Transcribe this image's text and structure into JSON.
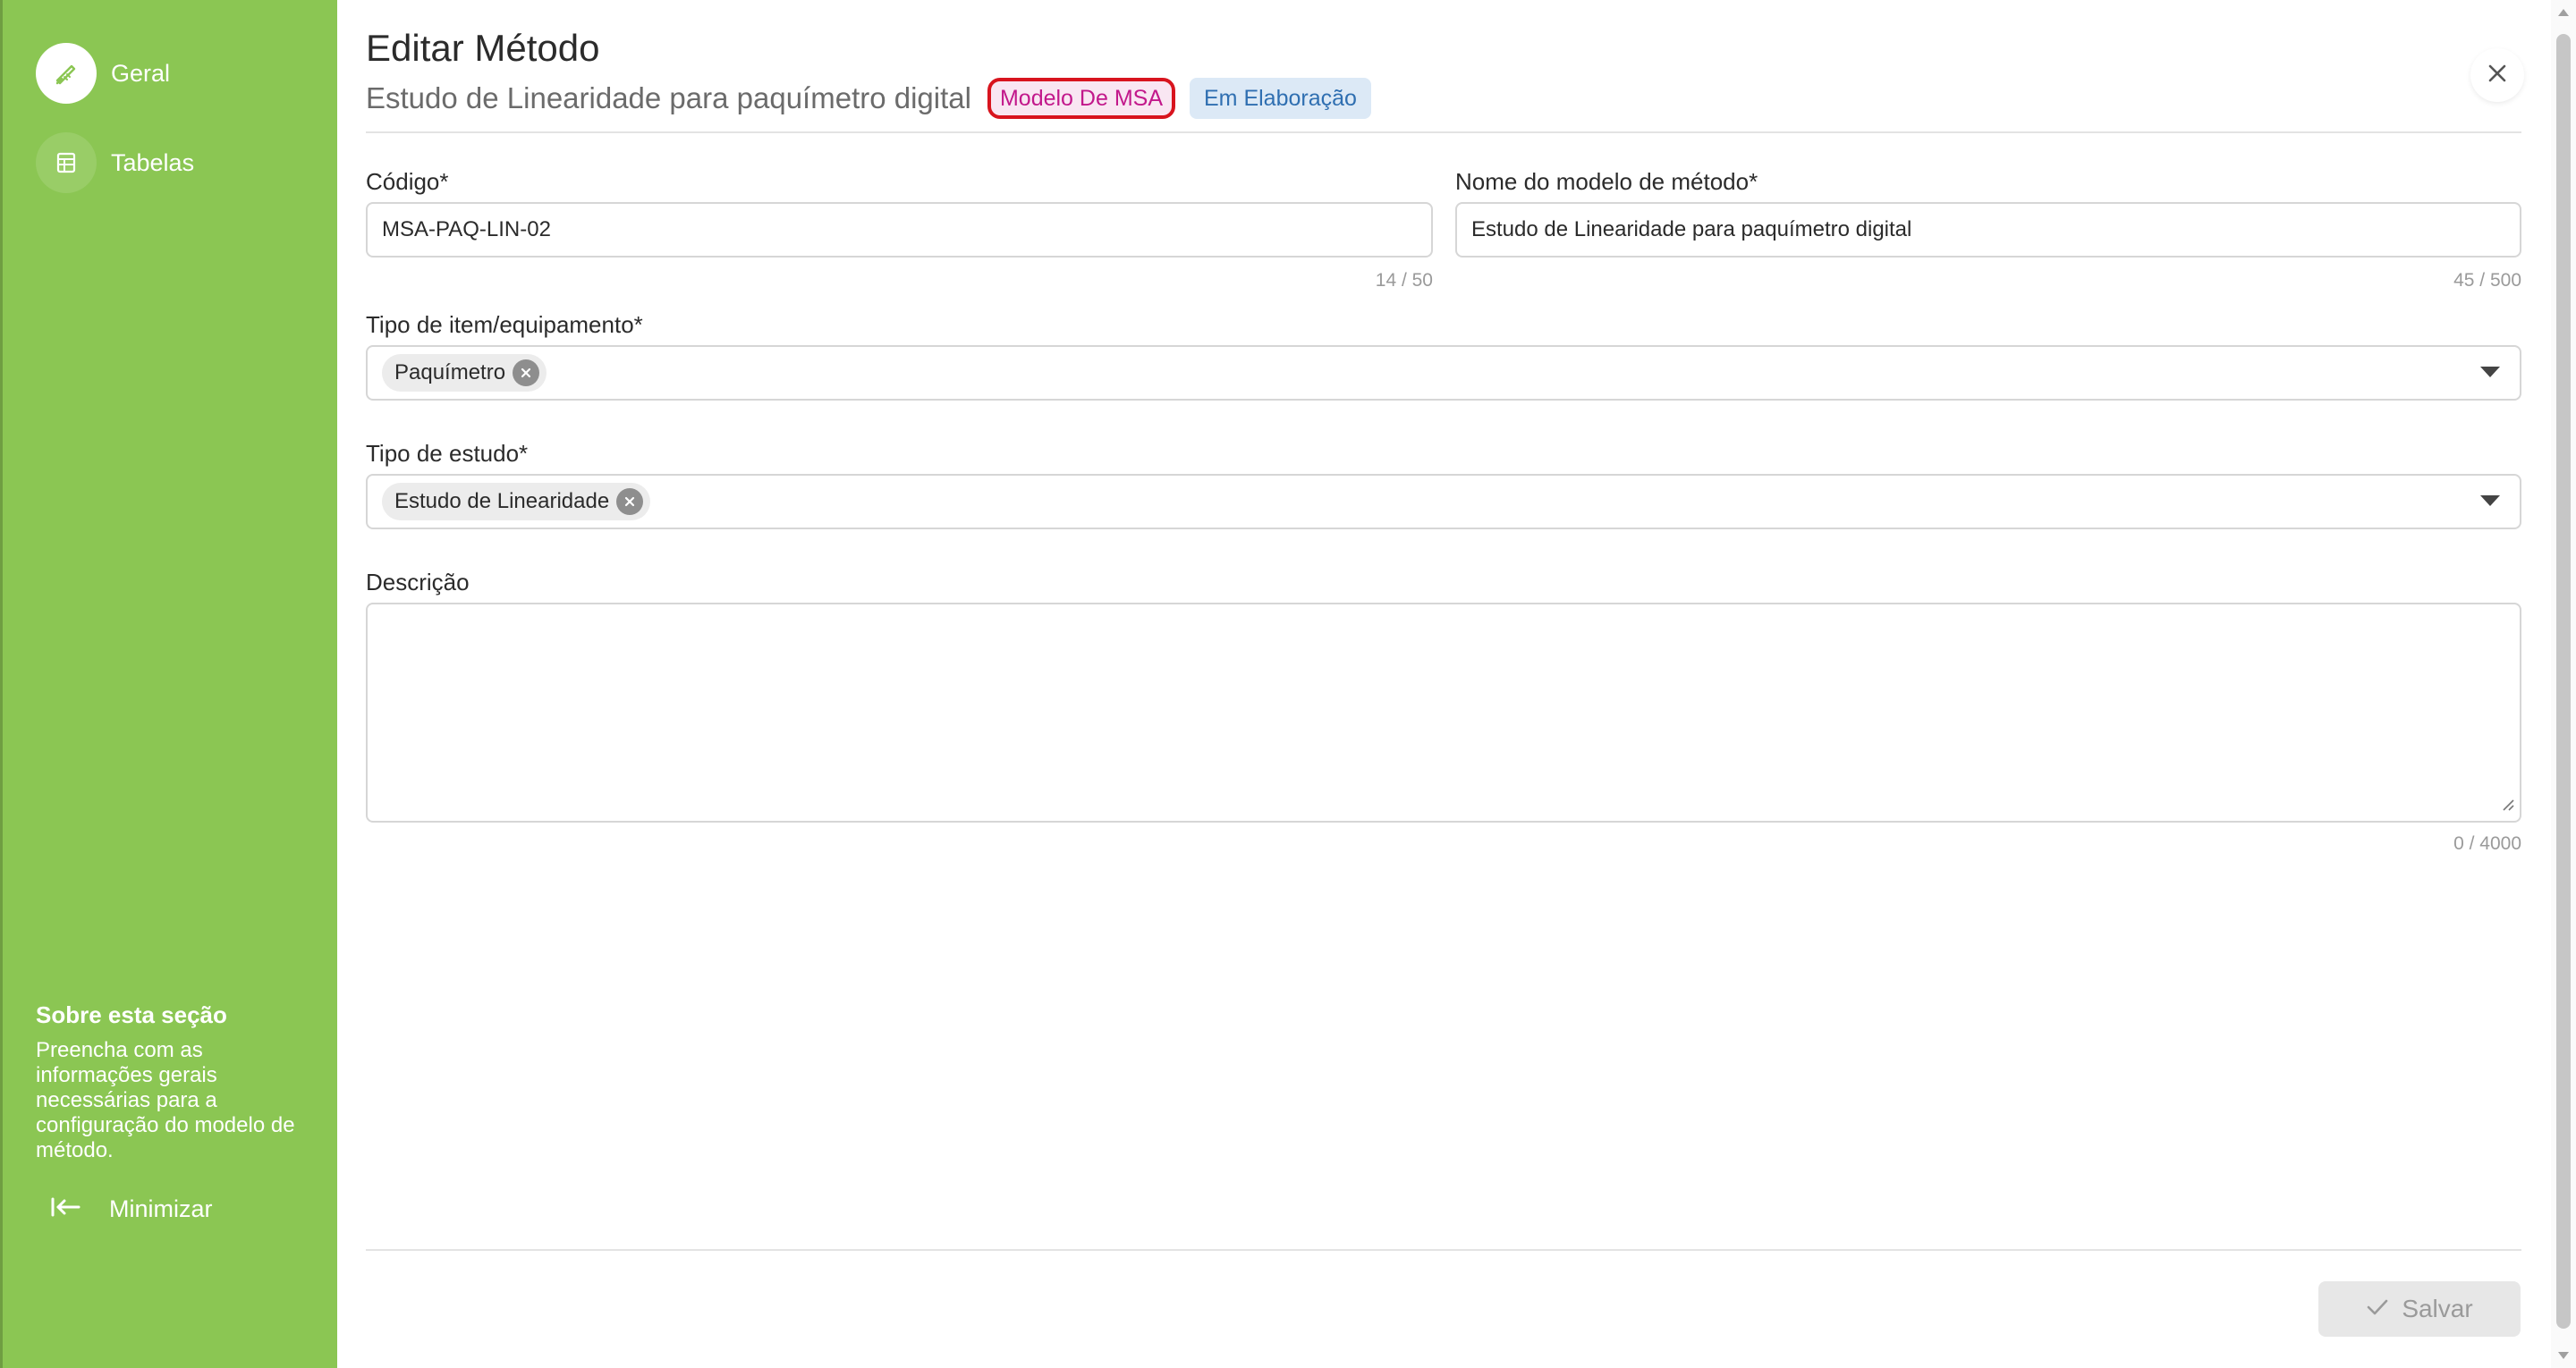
{
  "sidebar": {
    "items": [
      {
        "label": "Geral",
        "icon": "pen-ruler-icon",
        "active": true
      },
      {
        "label": "Tabelas",
        "icon": "table-icon",
        "active": false
      }
    ],
    "about_title": "Sobre esta seção",
    "about_text": "Preencha com as informações gerais necessárias para a configuração do modelo de método.",
    "minimize_label": "Minimizar",
    "colors": {
      "background": "#8bc653"
    }
  },
  "header": {
    "title": "Editar Método",
    "subtitle": "Estudo de Linearidade para paquímetro digital",
    "badge_type": "Modelo De MSA",
    "badge_status": "Em Elaboração"
  },
  "form": {
    "codigo": {
      "label": "Código*",
      "value": "MSA-PAQ-LIN-02",
      "counter": "14 / 50"
    },
    "nome": {
      "label": "Nome do modelo de método*",
      "value": "Estudo de Linearidade para paquímetro digital",
      "counter": "45 / 500"
    },
    "tipo_item": {
      "label": "Tipo de item/equipamento*",
      "chip": "Paquímetro"
    },
    "tipo_estudo": {
      "label": "Tipo de estudo*",
      "chip": "Estudo de Linearidade"
    },
    "descricao": {
      "label": "Descrição",
      "value": "",
      "counter": "0 / 4000"
    }
  },
  "footer": {
    "save_label": "Salvar"
  }
}
